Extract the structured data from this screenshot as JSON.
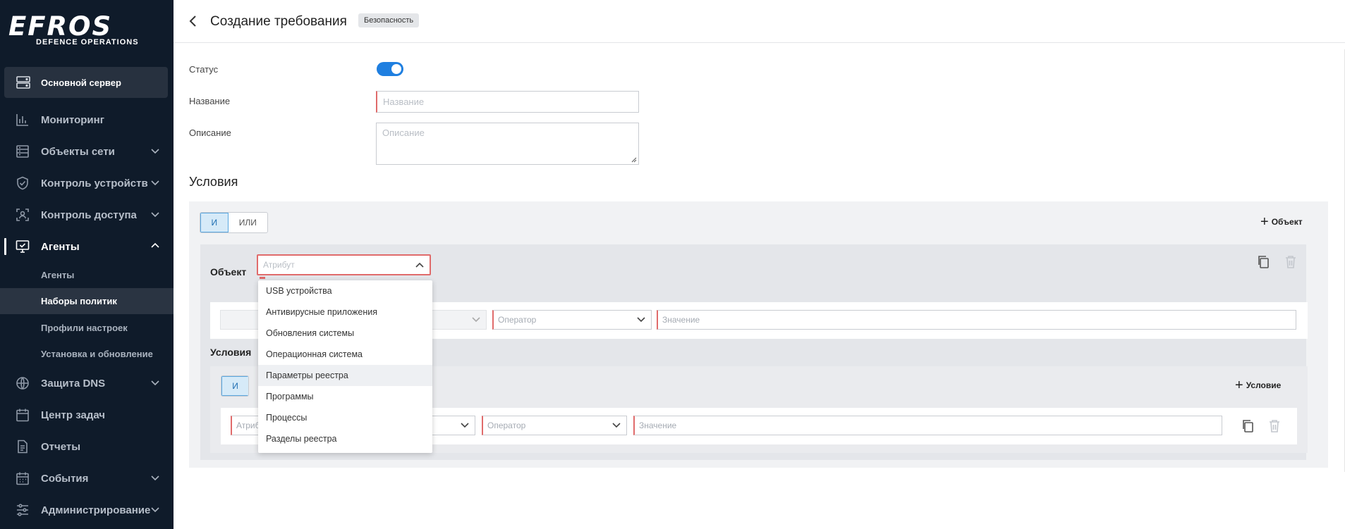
{
  "brand": {
    "logo_main": "EFROS",
    "logo_sub": "DEFENCE OPERATIONS"
  },
  "server": {
    "label": "Основной сервер"
  },
  "nav": {
    "monitoring": "Мониторинг",
    "network_objects": "Объекты сети",
    "device_control": "Контроль устройств",
    "access_control": "Контроль доступа",
    "agents": "Агенты",
    "sub_agents": "Агенты",
    "sub_policy_sets": "Наборы политик",
    "sub_settings_profiles": "Профили настроек",
    "sub_install_update": "Установка и обновление",
    "dns_protection": "Защита DNS",
    "task_center": "Центр задач",
    "reports": "Отчеты",
    "events": "События",
    "administration": "Администрирование"
  },
  "header": {
    "title": "Создание требования",
    "badge": "Безопасность"
  },
  "form": {
    "status_label": "Статус",
    "status_on": true,
    "name_label": "Название",
    "name_placeholder": "Название",
    "description_label": "Описание",
    "description_placeholder": "Описание"
  },
  "conditions": {
    "title": "Условия",
    "and_label": "И",
    "or_label": "ИЛИ",
    "add_object_label": "Объект",
    "object_label": "Объект",
    "attribute_placeholder": "Атрибут",
    "operator_placeholder": "Оператор",
    "value_placeholder": "Значение",
    "sub_title": "Условия",
    "sub_and_label": "И",
    "add_condition_label": "Условие",
    "sub_attribute_placeholder": "Атрибут",
    "sub_operator_placeholder": "Оператор",
    "sub_value_placeholder": "Значение"
  },
  "dropdown": {
    "items": [
      "USB устройства",
      "Антивирусные приложения",
      "Обновления системы",
      "Операционная система",
      "Параметры реестра",
      "Программы",
      "Процессы",
      "Разделы реестра"
    ],
    "hover_index": 4
  },
  "colors": {
    "sidebar_bg": "#0f1b2a",
    "accent": "#1f7fe0",
    "error": "#e06b6b"
  }
}
